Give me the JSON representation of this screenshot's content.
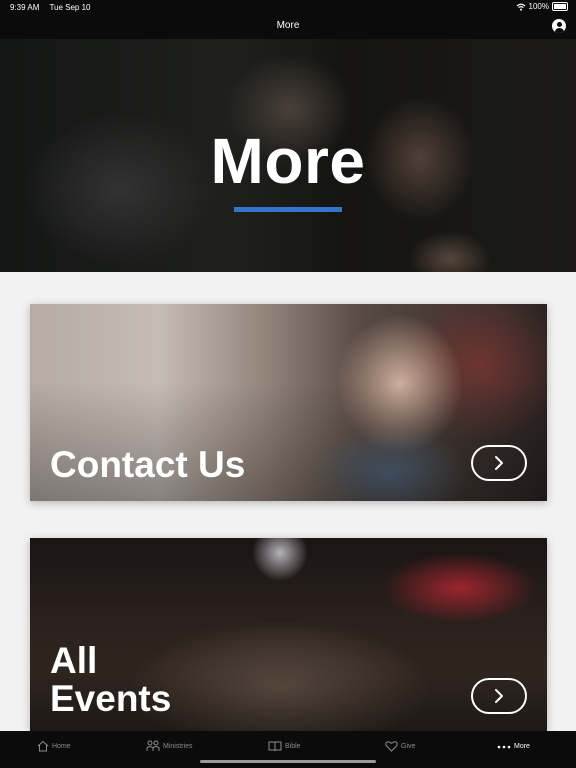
{
  "status_bar": {
    "time": "9:39 AM",
    "date": "Tue Sep 10",
    "battery": "100%"
  },
  "nav": {
    "title": "More",
    "profile_icon": "person-circle-icon"
  },
  "hero": {
    "title": "More",
    "accent_color": "#3574c9"
  },
  "cards": {
    "contact": {
      "title": "Contact Us",
      "arrow_icon": "chevron-right-icon"
    },
    "events": {
      "title_line1": "All",
      "title_line2": "Events",
      "arrow_icon": "chevron-right-icon"
    }
  },
  "tabs": [
    {
      "label": "Home",
      "icon": "home-icon"
    },
    {
      "label": "Ministries",
      "icon": "people-icon"
    },
    {
      "label": "Bible",
      "icon": "book-icon"
    },
    {
      "label": "Give",
      "icon": "heart-icon"
    },
    {
      "label": "More",
      "icon": "more-dots-icon",
      "active": true
    }
  ]
}
